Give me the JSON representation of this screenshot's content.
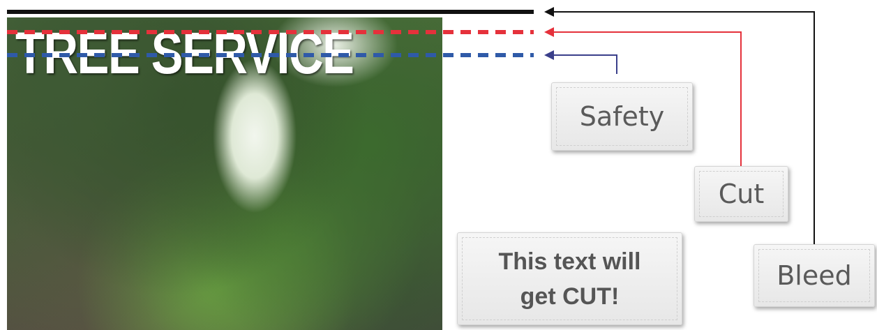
{
  "diagram": {
    "title": "TREE SERVICE",
    "labels": {
      "safety": "Safety",
      "cut": "Cut",
      "bleed": "Bleed"
    },
    "warning": {
      "line1": "This text will",
      "line2": "get CUT!"
    },
    "colors": {
      "bleed": "#111111",
      "cut": "#e5313b",
      "safety": "#2f5aa8"
    },
    "photo_subject": "forest-photo"
  }
}
